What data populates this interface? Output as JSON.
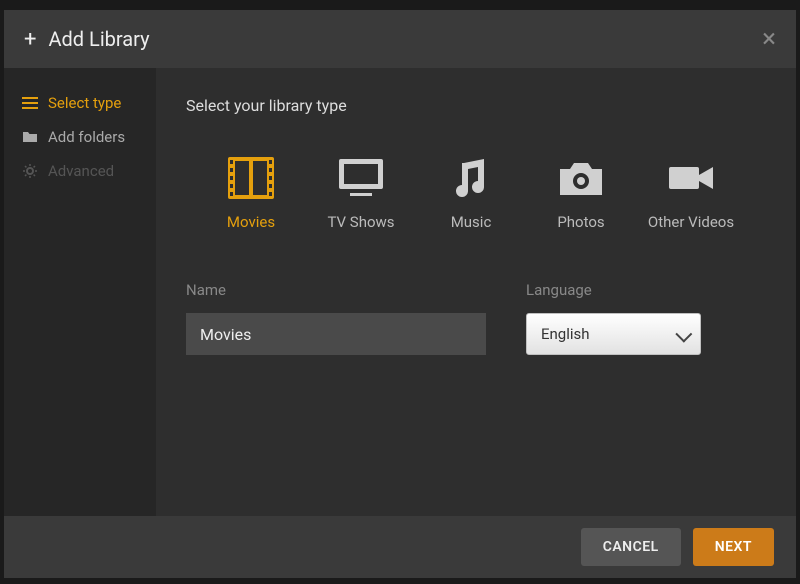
{
  "header": {
    "title": "Add Library"
  },
  "sidebar": [
    {
      "label": "Select type",
      "state": "active"
    },
    {
      "label": "Add folders",
      "state": "normal"
    },
    {
      "label": "Advanced",
      "state": "disabled"
    }
  ],
  "main": {
    "title": "Select your library type",
    "types": [
      {
        "label": "Movies",
        "active": true
      },
      {
        "label": "TV Shows",
        "active": false
      },
      {
        "label": "Music",
        "active": false
      },
      {
        "label": "Photos",
        "active": false
      },
      {
        "label": "Other Videos",
        "active": false
      }
    ],
    "nameLabel": "Name",
    "nameValue": "Movies",
    "langLabel": "Language",
    "langValue": "English"
  },
  "footer": {
    "cancel": "CANCEL",
    "next": "NEXT"
  }
}
